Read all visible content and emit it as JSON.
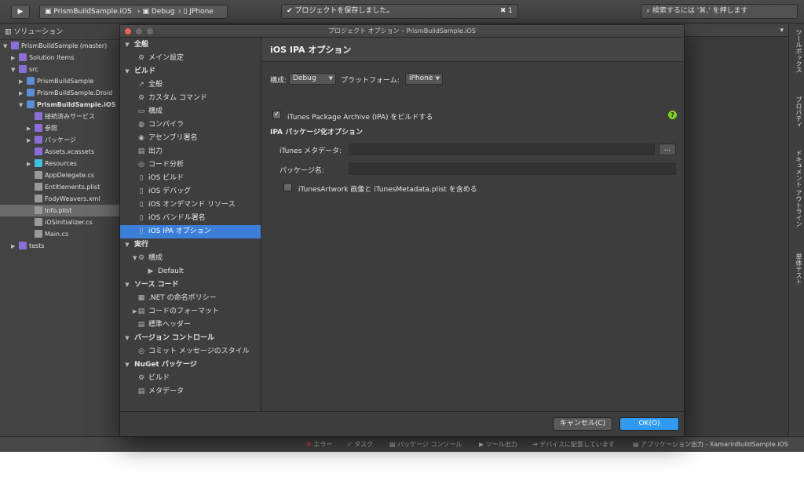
{
  "toolbar": {
    "project": "PrismBuildSample.iOS",
    "config": "Debug",
    "device": "JPhone",
    "status": "プロジェクトを保存しました。",
    "error_count": "1",
    "search_placeholder": "検索するには '⌘,' を押します"
  },
  "sidebar": {
    "title": "ソリューション",
    "items": [
      {
        "label": "PrismBuildSample (master)",
        "indent": 0,
        "tw": "▼",
        "color": "#8b6fd6",
        "bold": false
      },
      {
        "label": "Solution Items",
        "indent": 1,
        "tw": "▶",
        "color": "#8b6fd6",
        "bold": false
      },
      {
        "label": "src",
        "indent": 1,
        "tw": "▼",
        "color": "#8b6fd6",
        "bold": false
      },
      {
        "label": "PrismBuildSample",
        "indent": 2,
        "tw": "▶",
        "color": "#5a8fd6",
        "bold": false
      },
      {
        "label": "PrismBuildSample.Droid",
        "indent": 2,
        "tw": "▶",
        "color": "#5a8fd6",
        "bold": false
      },
      {
        "label": "PrismBuildSample.iOS",
        "indent": 2,
        "tw": "▼",
        "color": "#5a8fd6",
        "bold": true
      },
      {
        "label": "接続済みサービス",
        "indent": 3,
        "tw": "",
        "color": "#8b6fd6",
        "bold": false
      },
      {
        "label": "参照",
        "indent": 3,
        "tw": "▶",
        "color": "#8b6fd6",
        "bold": false
      },
      {
        "label": "パッケージ",
        "indent": 3,
        "tw": "▶",
        "color": "#8b6fd6",
        "bold": false
      },
      {
        "label": "Assets.xcassets",
        "indent": 3,
        "tw": "",
        "color": "#8b6fd6",
        "bold": false
      },
      {
        "label": "Resources",
        "indent": 3,
        "tw": "▶",
        "color": "#3ec0e0",
        "bold": false
      },
      {
        "label": "AppDelegate.cs",
        "indent": 3,
        "tw": "",
        "color": "#9a9a9a",
        "bold": false
      },
      {
        "label": "Entitlements.plist",
        "indent": 3,
        "tw": "",
        "color": "#9a9a9a",
        "bold": false
      },
      {
        "label": "FodyWeavers.xml",
        "indent": 3,
        "tw": "",
        "color": "#9a9a9a",
        "bold": false
      },
      {
        "label": "Info.plist",
        "indent": 3,
        "tw": "",
        "color": "#9a9a9a",
        "bold": false,
        "selected": true
      },
      {
        "label": "iOSInitializer.cs",
        "indent": 3,
        "tw": "",
        "color": "#9a9a9a",
        "bold": false
      },
      {
        "label": "Main.cs",
        "indent": 3,
        "tw": "",
        "color": "#9a9a9a",
        "bold": false
      },
      {
        "label": "tests",
        "indent": 1,
        "tw": "▶",
        "color": "#8b6fd6",
        "bold": false
      }
    ]
  },
  "right_panel": {
    "tabs": [
      "ツールボックス",
      "プロパティ",
      "ドキュメント アウトライン",
      "単体テスト"
    ]
  },
  "bottom_bar": {
    "items": [
      "エラー",
      "タスク",
      "パッケージ コンソール",
      "ツール出力",
      "デバイスに配置しています",
      "アプリケーション出力 - XamarinBuildSample.iOS"
    ]
  },
  "dialog": {
    "title": "プロジェクト オプション – PrismBuildSample.iOS",
    "nav": [
      {
        "label": "全般",
        "type": "cat",
        "indent": 0,
        "icon": "▼"
      },
      {
        "label": "メイン設定",
        "type": "item",
        "indent": 1,
        "icon": "⚙"
      },
      {
        "label": "ビルド",
        "type": "cat",
        "indent": 0,
        "icon": "▼"
      },
      {
        "label": "全般",
        "type": "item",
        "indent": 1,
        "icon": "↗"
      },
      {
        "label": "カスタム コマンド",
        "type": "item",
        "indent": 1,
        "icon": "⚙"
      },
      {
        "label": "構成",
        "type": "item",
        "indent": 1,
        "icon": "▭"
      },
      {
        "label": "コンパイラ",
        "type": "item",
        "indent": 1,
        "icon": "◍"
      },
      {
        "label": "アセンブリ署名",
        "type": "item",
        "indent": 1,
        "icon": "◉"
      },
      {
        "label": "出力",
        "type": "item",
        "indent": 1,
        "icon": "▤"
      },
      {
        "label": "コード分析",
        "type": "item",
        "indent": 1,
        "icon": "◎"
      },
      {
        "label": "iOS ビルド",
        "type": "item",
        "indent": 1,
        "icon": "▯"
      },
      {
        "label": "iOS デバッグ",
        "type": "item",
        "indent": 1,
        "icon": "▯"
      },
      {
        "label": "iOS オンデマンド リソース",
        "type": "item",
        "indent": 1,
        "icon": "▯"
      },
      {
        "label": "iOS バンドル署名",
        "type": "item",
        "indent": 1,
        "icon": "▯"
      },
      {
        "label": "iOS IPA オプション",
        "type": "item",
        "indent": 1,
        "icon": "▯",
        "selected": true
      },
      {
        "label": "実行",
        "type": "cat",
        "indent": 0,
        "icon": "▼"
      },
      {
        "label": "構成",
        "type": "item",
        "indent": 1,
        "icon": "⚙",
        "tw": "▼"
      },
      {
        "label": "Default",
        "type": "item",
        "indent": 2,
        "icon": "▶"
      },
      {
        "label": "ソース コード",
        "type": "cat",
        "indent": 0,
        "icon": "▼"
      },
      {
        "label": ".NET の命名ポリシー",
        "type": "item",
        "indent": 1,
        "icon": "▦"
      },
      {
        "label": "コードのフォーマット",
        "type": "item",
        "indent": 1,
        "icon": "▤",
        "tw": "▶"
      },
      {
        "label": "標準ヘッダー",
        "type": "item",
        "indent": 1,
        "icon": "▤"
      },
      {
        "label": "バージョン コントロール",
        "type": "cat",
        "indent": 0,
        "icon": "▼"
      },
      {
        "label": "コミット メッセージのスタイル",
        "type": "item",
        "indent": 1,
        "icon": "◎"
      },
      {
        "label": "NuGet パッケージ",
        "type": "cat",
        "indent": 0,
        "icon": "▼"
      },
      {
        "label": "ビルド",
        "type": "item",
        "indent": 1,
        "icon": "⚙"
      },
      {
        "label": "メタデータ",
        "type": "item",
        "indent": 1,
        "icon": "▤"
      }
    ],
    "header": "iOS IPA オプション",
    "config_label": "構成:",
    "config_value": "Debug",
    "platform_label": "プラットフォーム:",
    "platform_value": "iPhone",
    "build_ipa_label": "iTunes Package Archive (IPA) をビルドする",
    "build_ipa_checked": true,
    "section_title": "IPA パッケージ化オプション",
    "itunes_meta_label": "iTunes メタデータ:",
    "itunes_meta_value": "",
    "browse_label": "...",
    "package_name_label": "パッケージ名:",
    "package_name_value": "",
    "include_artwork_label": "iTunesArtwork 画像と iTunesMetadata.plist を含める",
    "include_artwork_checked": false,
    "help_icon": "?",
    "cancel_label": "キャンセル(C)",
    "ok_label": "OK(O)"
  }
}
